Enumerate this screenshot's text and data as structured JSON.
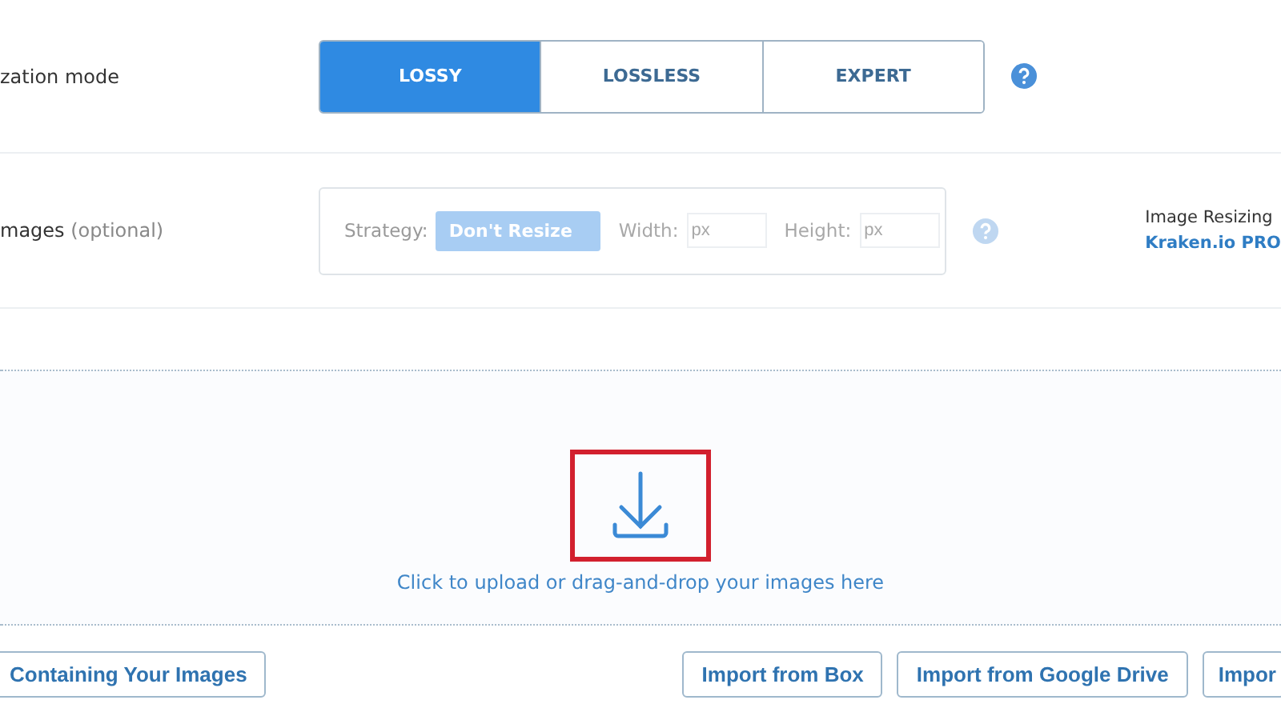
{
  "optimization": {
    "label": "zation mode",
    "modes": [
      {
        "label": "LOSSY",
        "selected": true
      },
      {
        "label": "LOSSLESS",
        "selected": false
      },
      {
        "label": "EXPERT",
        "selected": false
      }
    ]
  },
  "resize": {
    "label": "mages",
    "note": "(optional)",
    "disabled": true,
    "strategy_label": "Strategy:",
    "strategy_value": "Don't Resize",
    "width_label": "Width:",
    "width_placeholder": "px",
    "height_label": "Height:",
    "height_placeholder": "px",
    "pro_title": "Image Resizing",
    "pro_link": "Kraken.io PRO"
  },
  "upload": {
    "text": "Click to upload or drag-and-drop your images here",
    "highlighted": true
  },
  "import_buttons": [
    "Containing Your Images",
    "Import from Box",
    "Import from Google Drive",
    "Impor"
  ]
}
